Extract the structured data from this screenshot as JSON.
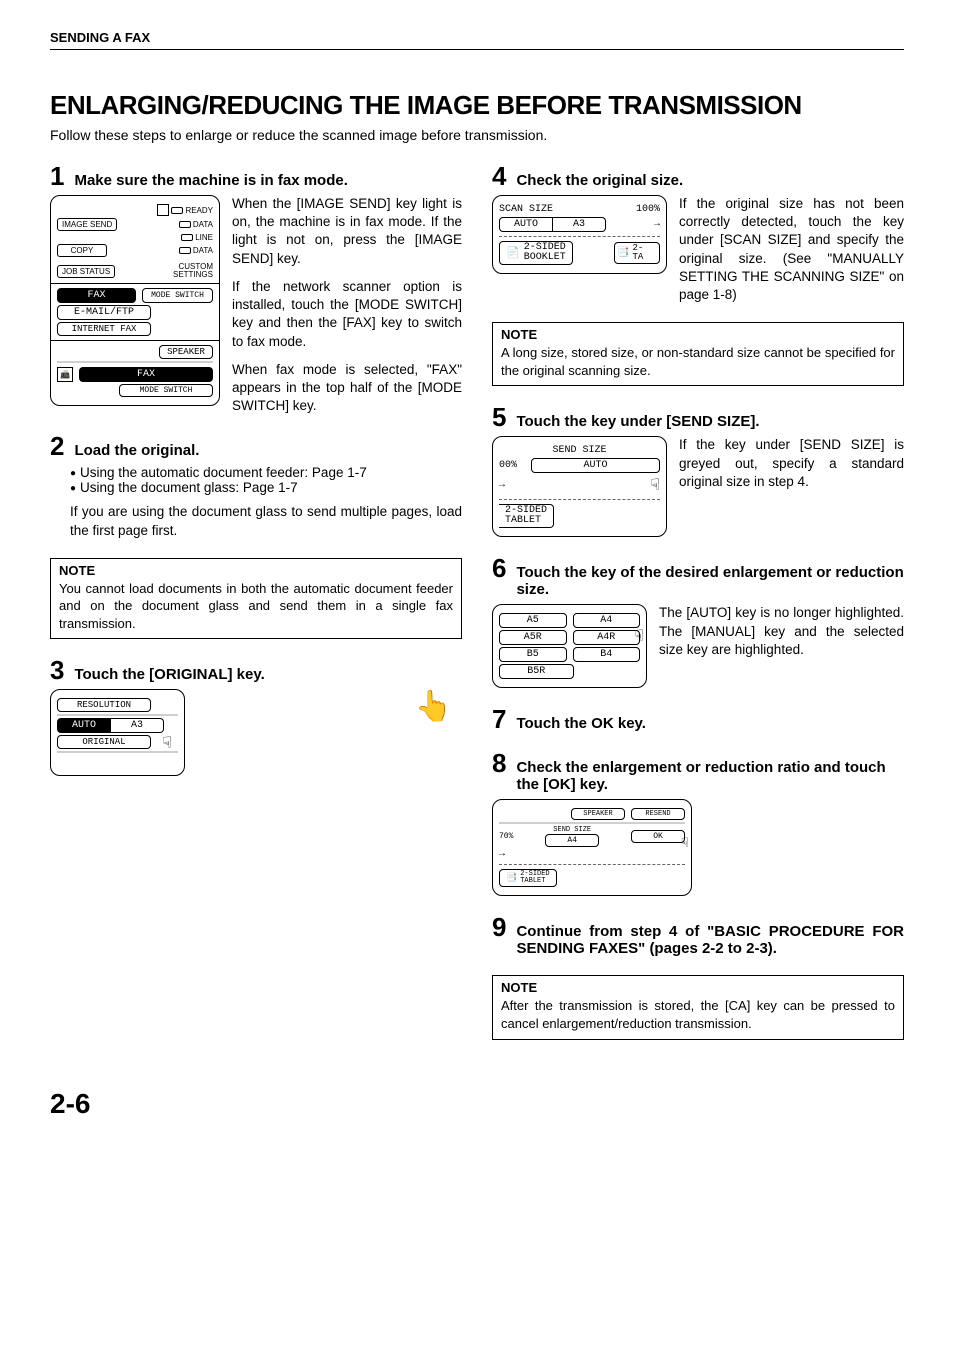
{
  "header": "SENDING A FAX",
  "title": "ENLARGING/REDUCING THE IMAGE BEFORE TRANSMISSION",
  "intro": "Follow these steps to enlarge or reduce the scanned image before transmission.",
  "page_number": "2-6",
  "steps": {
    "s1": {
      "num": "1",
      "title": "Make sure the machine is in fax mode.",
      "p1": "When the [IMAGE SEND] key light is on, the machine is in fax mode. If the light is not on, press the [IMAGE SEND] key.",
      "p2": "If the network scanner option is installed, touch the [MODE SWITCH] key and then the [FAX] key to switch to fax mode.",
      "p3": "When fax mode is selected, \"FAX\" appears in the top half of the [MODE SWITCH] key."
    },
    "s2": {
      "num": "2",
      "title": "Load the original.",
      "b1": "Using the automatic document feeder: Page 1-7",
      "b2": "Using the document glass: Page 1-7",
      "p1": "If you are using the document glass to send multiple pages, load the first page first."
    },
    "note1": {
      "title": "NOTE",
      "body": "You cannot load documents in both the automatic document feeder and on the document glass and send them in a single fax transmission."
    },
    "s3": {
      "num": "3",
      "title": "Touch the [ORIGINAL] key."
    },
    "s4": {
      "num": "4",
      "title": "Check the original size.",
      "p1": "If the original size has not been correctly detected, touch the key under [SCAN SIZE] and specify the original size. (See \"MANUALLY SETTING THE SCANNING SIZE\" on page 1-8)"
    },
    "note2": {
      "title": "NOTE",
      "body": "A long size, stored size, or non-standard size cannot be specified for the original scanning size."
    },
    "s5": {
      "num": "5",
      "title": "Touch the key under [SEND SIZE].",
      "p1": "If the key under [SEND SIZE] is greyed out, specify a standard original size in step 4."
    },
    "s6": {
      "num": "6",
      "title": "Touch the key of the desired enlargement or reduction size.",
      "p1": "The [AUTO] key is no longer highlighted. The [MANUAL] key and the selected size key are highlighted."
    },
    "s7": {
      "num": "7",
      "title": "Touch the OK key."
    },
    "s8": {
      "num": "8",
      "title": "Check the enlargement or reduction ratio and touch the [OK] key."
    },
    "s9": {
      "num": "9",
      "title": "Continue from step 4 of \"BASIC PROCEDURE FOR SENDING FAXES\" (pages 2-2 to 2-3)."
    },
    "note3": {
      "title": "NOTE",
      "body": "After the transmission is stored, the [CA] key can be pressed to cancel enlargement/reduction transmission."
    }
  },
  "panels": {
    "p1": {
      "ready": "READY",
      "data1": "DATA",
      "image_send": "IMAGE SEND",
      "line": "LINE",
      "data2": "DATA",
      "copy": "COPY",
      "job_status": "JOB STATUS",
      "custom_settings": "CUSTOM\nSETTINGS",
      "fax": "FAX",
      "mode_switch": "MODE SWITCH",
      "email": "E-MAIL/FTP",
      "internet_fax": "INTERNET FAX",
      "speaker": "SPEAKER",
      "fax2": "FAX",
      "mode_switch2": "MODE SWITCH"
    },
    "p3": {
      "resolution": "RESOLUTION",
      "auto": "AUTO",
      "a3": "A3",
      "original": "ORIGINAL"
    },
    "p4": {
      "scan_size": "SCAN SIZE",
      "auto": "AUTO",
      "a3": "A3",
      "pct": "100%",
      "two_sided": "2-SIDED",
      "booklet": "BOOKLET",
      "two": "2-",
      "ta": "TA"
    },
    "p5": {
      "send_size": "SEND SIZE",
      "pct": "00%",
      "auto": "AUTO",
      "two_sided": "2-SIDED",
      "tablet": "TABLET"
    },
    "p6": {
      "a5": "A5",
      "a4": "A4",
      "a5r": "A5R",
      "a4r": "A4R",
      "b5": "B5",
      "b4": "B4",
      "b5r": "B5R"
    },
    "p8": {
      "speaker": "SPEAKER",
      "resend": "RESEND",
      "send_size": "SEND SIZE",
      "ok": "OK",
      "pct": "70%",
      "a4": "A4",
      "two_sided": "2-SIDED",
      "tablet": "TABLET"
    }
  }
}
